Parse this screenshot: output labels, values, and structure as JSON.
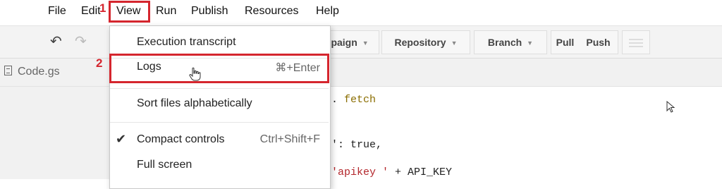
{
  "menubar": {
    "items": [
      "File",
      "Edit",
      "View",
      "Run",
      "Publish",
      "Resources",
      "Help"
    ],
    "step1": "1"
  },
  "toolbar": {
    "undo_icon": "undo-icon",
    "redo_icon": "redo-icon",
    "campaign_label": "mpaign",
    "repository_label": "Repository",
    "branch_label": "Branch",
    "pull_label": "Pull",
    "push_label": "Push"
  },
  "file": {
    "name": "Code.gs",
    "icon": "document-icon"
  },
  "code": {
    "line1_suffix": ". ",
    "line1_kw": "fetch",
    "line2_prefix": "': ",
    "line2_value": "true,",
    "line3_str": "'apikey '",
    "line3_rest": " + API_KEY"
  },
  "view_menu": {
    "step2": "2",
    "items": [
      {
        "label": "Execution transcript",
        "shortcut": "",
        "checked": false
      },
      {
        "label": "Logs",
        "shortcut": "⌘+Enter",
        "checked": false
      },
      {
        "label": "Sort files alphabetically",
        "shortcut": "",
        "checked": false
      },
      {
        "label": "Compact controls",
        "shortcut": "Ctrl+Shift+F",
        "checked": true
      },
      {
        "label": "Full screen",
        "shortcut": "",
        "checked": false
      }
    ],
    "check_mark": "✔"
  },
  "colors": {
    "highlight": "#d5262e",
    "toolbar_bg": "#f3f3f3"
  }
}
